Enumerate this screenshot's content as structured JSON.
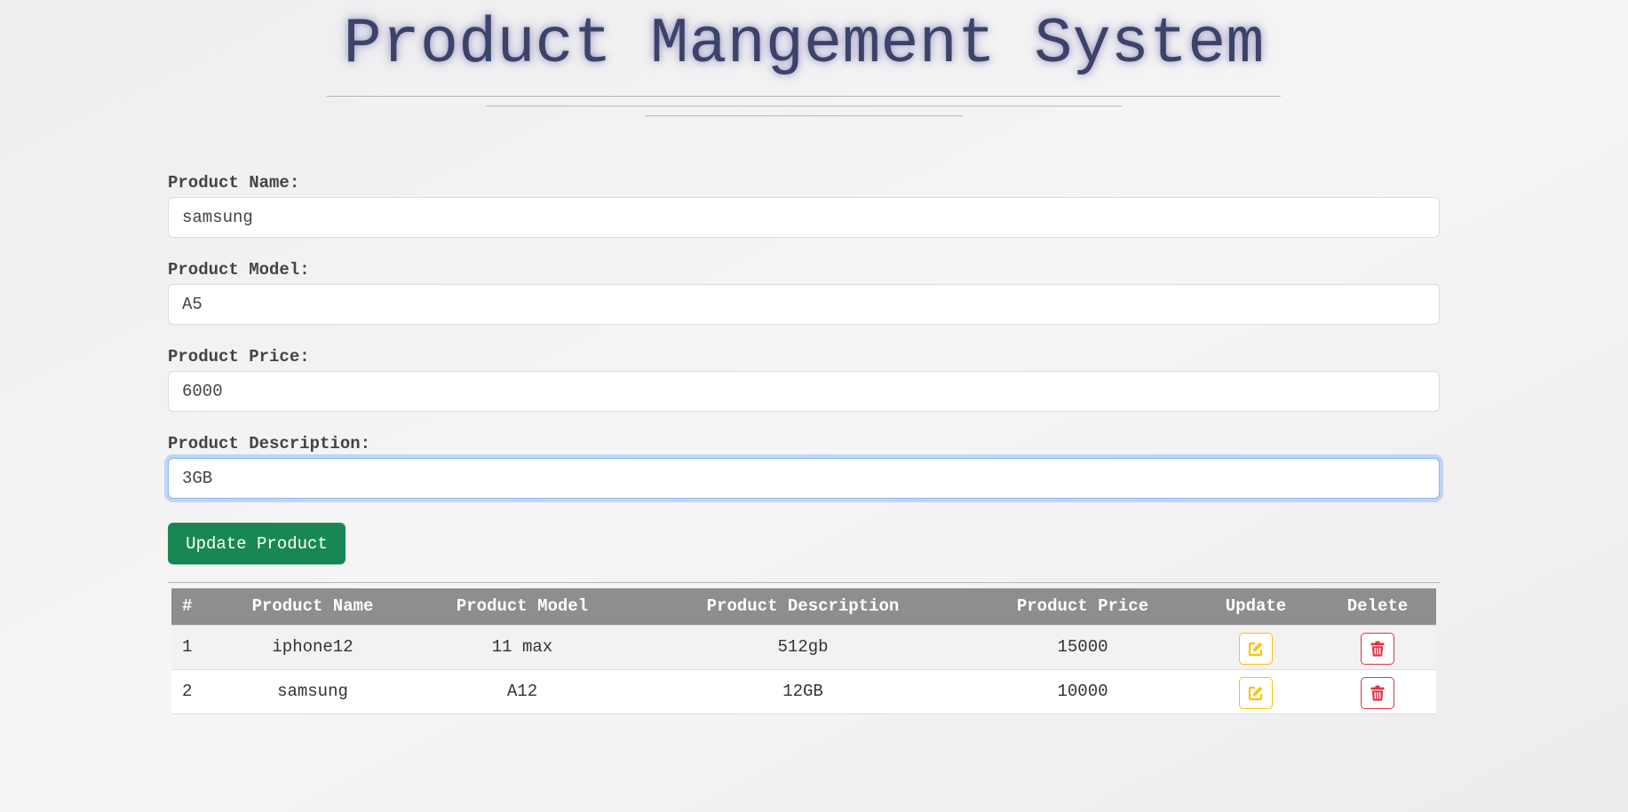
{
  "title": "Product Mangement System",
  "form": {
    "fields": [
      {
        "label": "Product Name:",
        "value": "samsung"
      },
      {
        "label": "Product Model:",
        "value": "A5"
      },
      {
        "label": "Product Price:",
        "value": "6000"
      },
      {
        "label": "Product Description:",
        "value": "3GB"
      }
    ],
    "submit_label": "Update Product"
  },
  "table": {
    "headers": [
      "#",
      "Product Name",
      "Product Model",
      "Product Description",
      "Product Price",
      "Update",
      "Delete"
    ],
    "rows": [
      {
        "num": "1",
        "name": "iphone12",
        "model": "11 max",
        "description": "512gb",
        "price": "15000"
      },
      {
        "num": "2",
        "name": "samsung",
        "model": "A12",
        "description": "12GB",
        "price": "10000"
      }
    ]
  },
  "icons": {
    "update": "pencil-square-icon",
    "delete": "trash-icon"
  },
  "colors": {
    "title": "#3d4368",
    "submit_button": "#198754",
    "table_header": "#8e8e8e",
    "update_icon": "#ffc107",
    "delete_icon": "#dc3545",
    "focus_ring": "#86b7fe"
  }
}
